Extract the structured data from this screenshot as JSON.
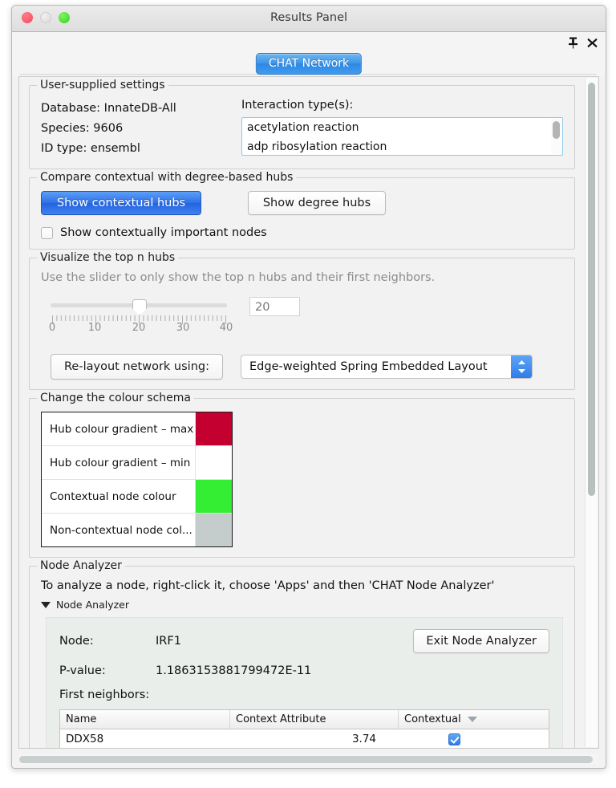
{
  "window": {
    "title": "Results Panel",
    "traffic_lights": [
      "close-red",
      "minimize-grey",
      "zoom-green"
    ],
    "pin_icon": "pushpin-icon",
    "close_icon": "close-icon"
  },
  "tab": {
    "label": "CHAT Network"
  },
  "user_settings": {
    "legend": "User-supplied settings",
    "database": "Database: InnateDB-All",
    "species": "Species: 9606",
    "id_type": "ID type: ensembl",
    "interaction_label": "Interaction type(s):",
    "interaction_items": [
      "acetylation reaction",
      "adp ribosylation reaction"
    ]
  },
  "compare": {
    "legend": "Compare contextual with degree-based hubs",
    "contextual_hubs_button": "Show contextual hubs",
    "degree_hubs_button": "Show degree hubs",
    "checkbox_label": "Show contextually important nodes",
    "checkbox_checked": "false"
  },
  "visualize": {
    "legend": "Visualize the top n hubs",
    "hint": "Use the slider to only show the top n hubs and their first neighbors.",
    "slider_value": "20",
    "slider_min": "0",
    "slider_max": "40",
    "tick_labels": [
      "0",
      "10",
      "20",
      "30",
      "40"
    ],
    "value_field": "20",
    "relayout_button": "Re-layout network using:",
    "layout_selected": "Edge-weighted Spring Embedded Layout"
  },
  "colour_schema": {
    "legend": "Change the colour schema",
    "rows": [
      {
        "name": "Hub colour gradient – max",
        "colour": "#C3002F"
      },
      {
        "name": "Hub colour gradient – min",
        "colour": "#FFFFFF"
      },
      {
        "name": "Contextual node colour",
        "colour": "#33EE33"
      },
      {
        "name": "Non-contextual node col...",
        "colour": "#C4CCCC"
      }
    ]
  },
  "node_analyzer": {
    "legend": "Node Analyzer",
    "instruction": "To analyze a node, right-click it, choose 'Apps' and then 'CHAT Node Analyzer'",
    "disclosure_label": "Node Analyzer",
    "node_key": "Node:",
    "node_value": "IRF1",
    "exit_button": "Exit Node Analyzer",
    "pvalue_key": "P-value:",
    "pvalue_value": "1.1863153881799472E-11",
    "first_neighbors_label": "First neighbors:",
    "table": {
      "columns": [
        "Name",
        "Context Attribute",
        "Contextual"
      ],
      "sorted_column": "Contextual",
      "rows": [
        {
          "name": "DDX58",
          "context_attribute": "3.74",
          "contextual": "true"
        }
      ]
    }
  },
  "colors": {
    "accent_blue": "#2F7CE8",
    "tab_blue": "#3D94E8",
    "panel_bg": "#F2F2F2",
    "inner_panel_bg": "#E9EEEA"
  }
}
